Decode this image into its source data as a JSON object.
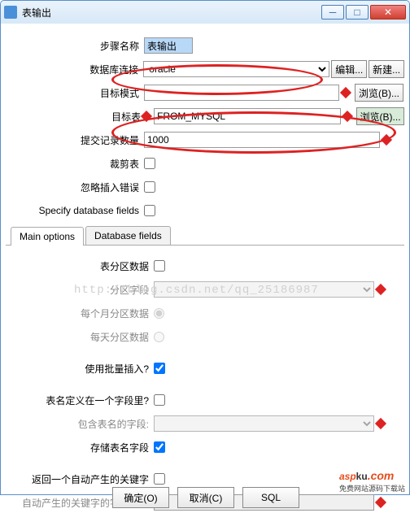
{
  "window": {
    "title": "表输出"
  },
  "fields": {
    "step_name": {
      "label": "步骤名称",
      "value": "表输出"
    },
    "db_conn": {
      "label": "数据库连接",
      "value": "oracle",
      "edit": "编辑...",
      "new": "新建..."
    },
    "schema": {
      "label": "目标模式",
      "value": "",
      "browse": "浏览(B)..."
    },
    "table": {
      "label": "目标表",
      "value": "FROM_MYSQL",
      "browse": "浏览(B)..."
    },
    "commit": {
      "label": "提交记录数量",
      "value": "1000"
    },
    "truncate": {
      "label": "裁剪表"
    },
    "ignore": {
      "label": "忽略插入错误"
    },
    "specify": {
      "label": "Specify database fields"
    }
  },
  "tabs": {
    "main": "Main options",
    "dbf": "Database fields"
  },
  "opts": {
    "partition": {
      "label": "表分区数据"
    },
    "part_field": {
      "label": "分区字段"
    },
    "monthly": {
      "label": "每个月分区数据"
    },
    "daily": {
      "label": "每天分区数据"
    },
    "batch": {
      "label": "使用批量插入?"
    },
    "name_in_field": {
      "label": "表名定义在一个字段里?"
    },
    "field_contain": {
      "label": "包含表名的字段:"
    },
    "store_name": {
      "label": "存储表名字段"
    },
    "gen_key": {
      "label": "返回一个自动产生的关键字"
    },
    "gen_key_name": {
      "label": "自动产生的关键字的字段名称"
    }
  },
  "buttons": {
    "ok": "确定(O)",
    "cancel": "取消(C)",
    "sql": "SQL"
  },
  "watermark": "http://blog.csdn.net/qq_25186987",
  "brand": {
    "a": "asp",
    "b": "ku",
    "c": ".com",
    "sub": "免费网站源码下载站"
  }
}
